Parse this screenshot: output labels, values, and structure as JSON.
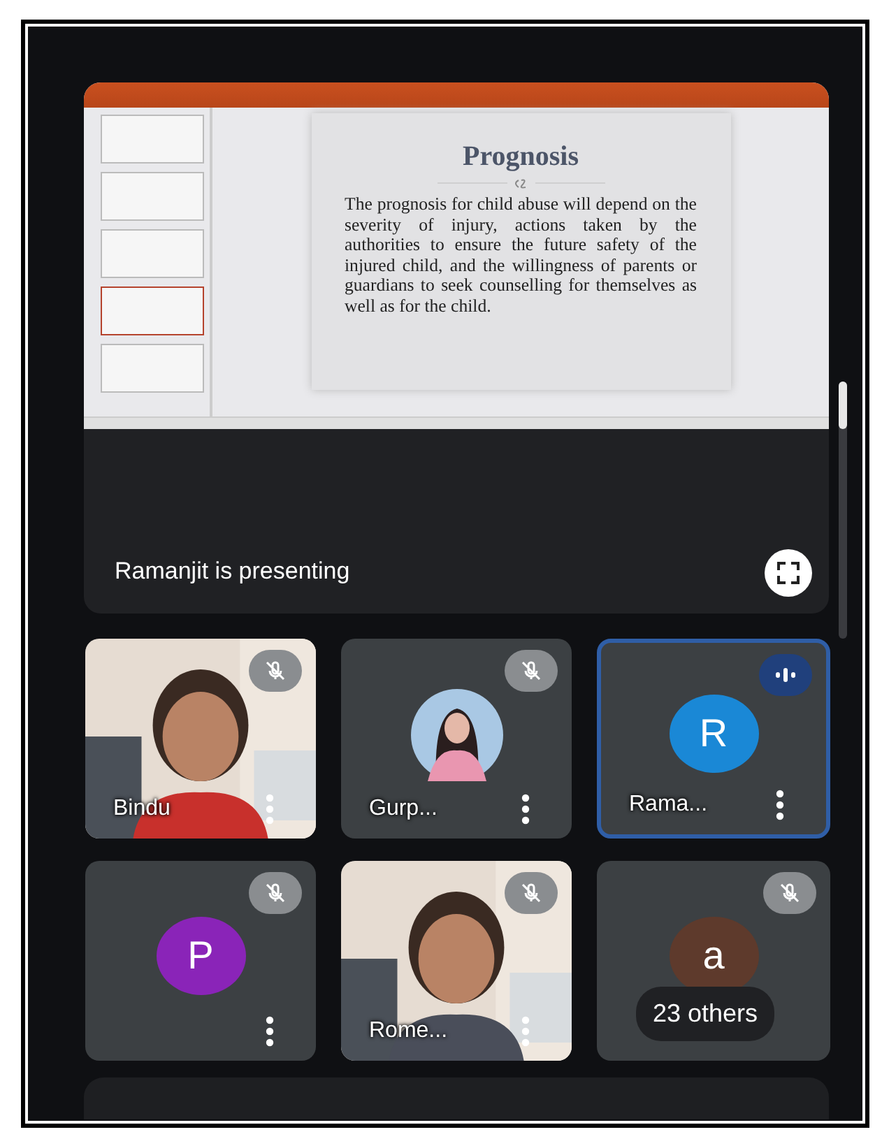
{
  "presentation": {
    "slide_title": "Prognosis",
    "slide_body": "The prognosis for child abuse will depend on the severity of injury, actions taken by the authorities to ensure the future safety of the injured child, and the willingness of parents or guardians to seek counselling for themselves as well as for the child.",
    "thumbnails": [
      {
        "selected": false
      },
      {
        "selected": false
      },
      {
        "selected": false
      },
      {
        "selected": true
      },
      {
        "selected": false
      }
    ],
    "presenter_label": "Ramanjit is presenting"
  },
  "tiles": [
    {
      "kind": "video",
      "name": "Bindu",
      "muted": true,
      "speaking": false
    },
    {
      "name": "Gurp...",
      "muted": true,
      "speaking": false
    },
    {
      "kind": "avatar",
      "name": "Rama...",
      "letter": "R",
      "color": "#1a88d6",
      "muted": false,
      "speaking": true
    },
    {
      "kind": "avatar",
      "letter": "P",
      "color": "#8a24b8",
      "muted": true,
      "speaking": false
    },
    {
      "kind": "video",
      "name": "Rome...",
      "muted": true,
      "speaking": false
    },
    {
      "kind": "avatar",
      "letter": "a",
      "color": "#5e3a2c",
      "muted": true,
      "speaking": false,
      "overlay": "23 others"
    }
  ]
}
